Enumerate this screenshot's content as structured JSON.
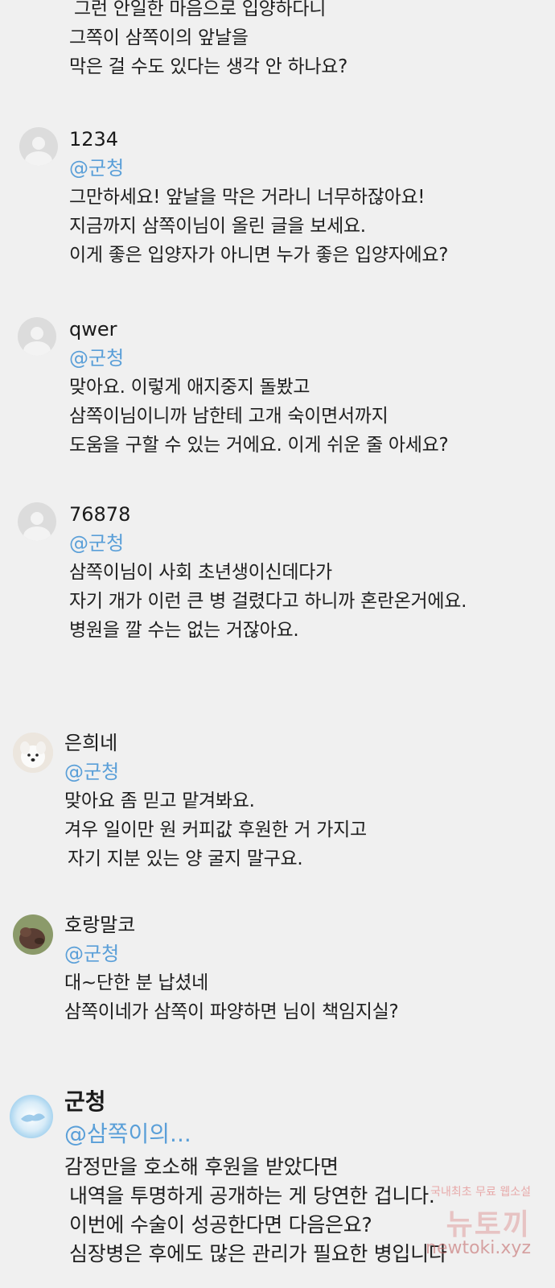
{
  "intro_lines": [
    "그런 안일한 마음으로 입양하다니",
    "그쪽이 삼쪽이의 앞날을",
    "막은 걸 수도 있다는 생각 안 하나요?"
  ],
  "comments": [
    {
      "user": "1234",
      "mention": "@군청",
      "lines": [
        "그만하세요! 앞날을 막은 거라니 너무하잖아요!",
        "지금까지 삼쪽이님이 올린 글을 보세요.",
        "이게 좋은 입양자가 아니면 누가 좋은 입양자에요?"
      ]
    },
    {
      "user": "qwer",
      "mention": "@군청",
      "lines": [
        "맞아요. 이렇게 애지중지 돌봤고",
        "삼쪽이님이니까 남한테 고개 숙이면서까지",
        "도움을 구할 수 있는 거에요. 이게 쉬운 줄 아세요?"
      ]
    },
    {
      "user": "76878",
      "mention": "@군청",
      "lines": [
        "삼쪽이님이 사회 초년생이신데다가",
        "자기 개가 이런 큰 병 걸렸다고 하니까 혼란온거에요.",
        "병원을 깔 수는 없는 거잖아요."
      ]
    },
    {
      "user": "은희네",
      "mention": "@군청",
      "lines": [
        "맞아요 좀 믿고 맡겨봐요.",
        "겨우 일이만 원 커피값 후원한 거 가지고",
        "자기 지분 있는 양 굴지 말구요."
      ]
    },
    {
      "user": "호랑말코",
      "mention": "@군청",
      "lines": [
        "대~단한 분 납셨네",
        "삼쪽이네가 삼쪽이 파양하면 님이 책임지실?"
      ]
    },
    {
      "user": "군청",
      "mention": "@삼쪽이의...",
      "lines": [
        "감정만을 호소해 후원을 받았다면",
        "내역을 투명하게 공개하는 게 당연한 겁니다.",
        "이번에 수술이 성공한다면 다음은요?",
        "심장병은 후에도 많은 관리가 필요한 병입니다"
      ]
    }
  ],
  "watermark": {
    "line1": "국내최초 무료 웹소설",
    "line2": "뉴토끼",
    "line3": "newtoki.xyz"
  }
}
